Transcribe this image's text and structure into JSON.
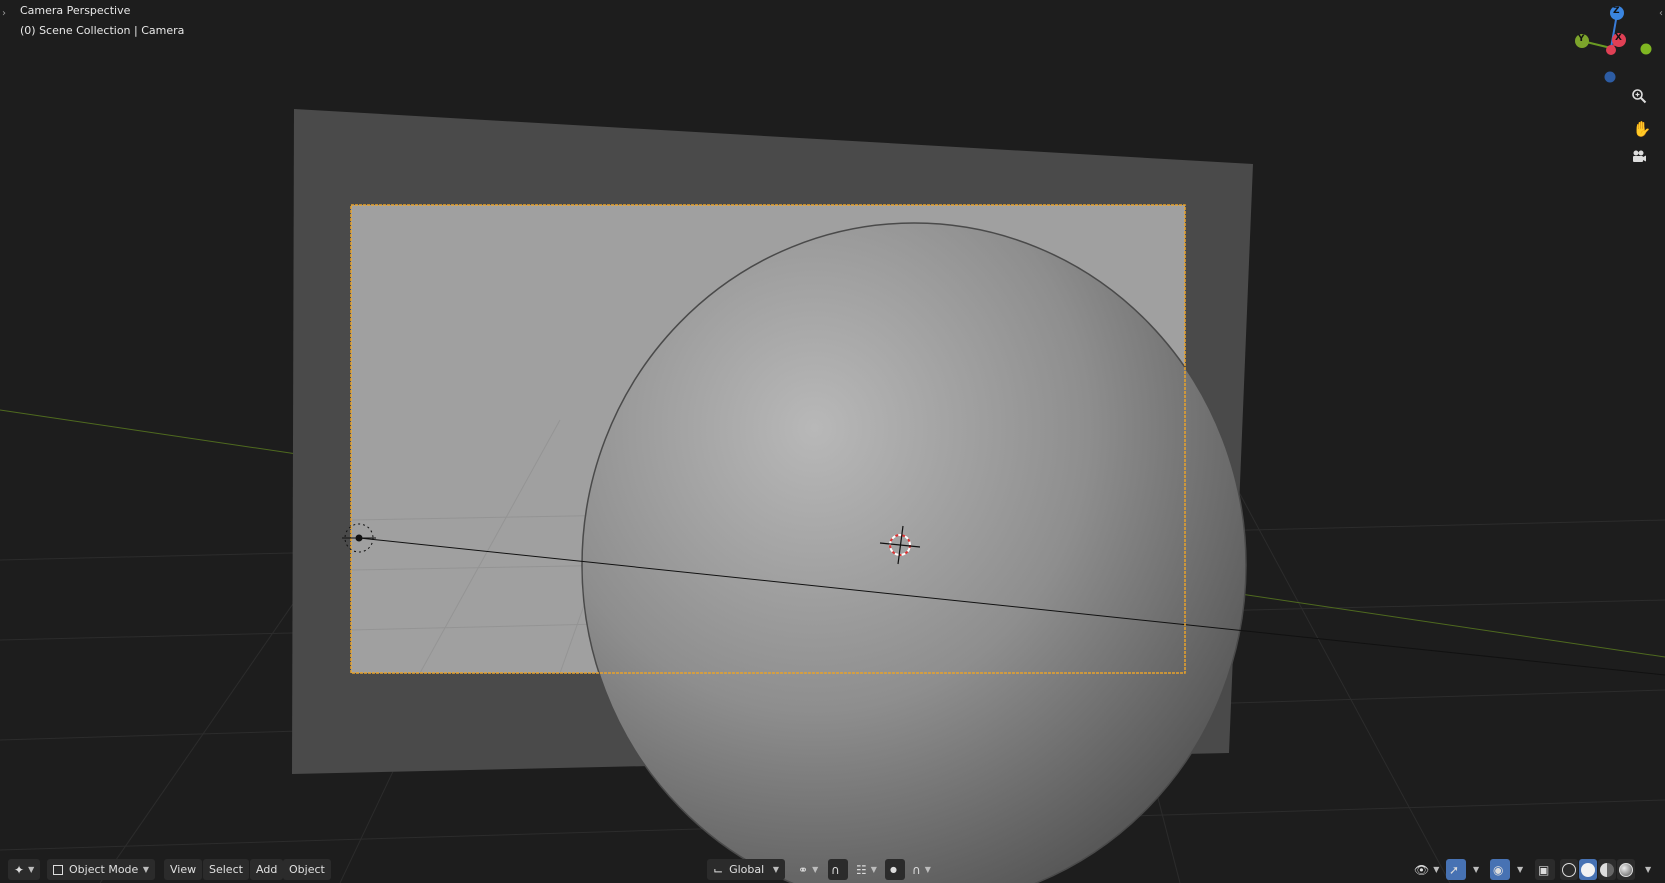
{
  "viewport": {
    "title": "Camera Perspective",
    "subtitle": "(0) Scene Collection | Camera"
  },
  "gizmo": {
    "z": "Z",
    "y": "Y",
    "x": "X"
  },
  "nav_icons": [
    "zoom-icon",
    "pan-hand-icon",
    "camera-view-icon"
  ],
  "header": {
    "editor_type_icon": "viewport-icon",
    "mode": "Object Mode",
    "menus": {
      "view": "View",
      "select": "Select",
      "add": "Add",
      "object": "Object"
    },
    "transform_orientation": "Global",
    "colors": {
      "active": "#4772b3",
      "button": "#2b2b2b",
      "selection_outline": "#e8a22b"
    }
  }
}
